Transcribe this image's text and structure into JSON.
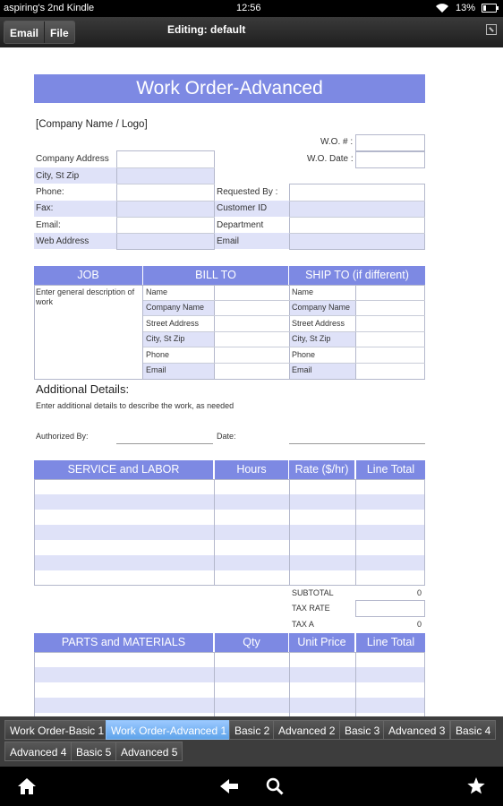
{
  "status": {
    "device": "aspiring's 2nd Kindle",
    "time": "12:56",
    "battery": "13%"
  },
  "appbar": {
    "email_label": "Email",
    "file_label": "File",
    "title": "Editing: default"
  },
  "doc": {
    "title": "Work Order-Advanced",
    "company_logo": "[Company Name / Logo]",
    "wo_num_label": "W.O. # :",
    "wo_date_label": "W.O. Date :",
    "company_address": "Company Address",
    "city_st_zip": "City, St Zip",
    "phone": "Phone:",
    "fax": "Fax:",
    "email": "Email:",
    "web_address": "Web Address",
    "requested_by": "Requested By :",
    "customer_id": "Customer ID",
    "department": "Department",
    "email2": "Email",
    "job_header": "JOB",
    "bill_to_header": "BILL TO",
    "ship_to_header": "SHIP TO (if different)",
    "job_desc": "Enter general description of work",
    "bill_fields": [
      "Name",
      "Company Name",
      "Street Address",
      "City, St Zip",
      "Phone",
      "Email"
    ],
    "ship_fields": [
      "Name",
      "Company Name",
      "Street Address",
      "City, St Zip",
      "Phone",
      "Email"
    ],
    "additional_details_label": "Additional Details:",
    "additional_details_text": "Enter additional details to describe the work, as needed",
    "authorized_by": "Authorized By:",
    "date": "Date:",
    "service_header": [
      "SERVICE and LABOR",
      "Hours",
      "Rate ($/hr)",
      "Line Total"
    ],
    "subtotal_label": "SUBTOTAL",
    "subtotal_value": "0",
    "tax_rate_label": "TAX RATE",
    "tax_a_label": "TAX A",
    "tax_a_value": "0",
    "parts_header": [
      "PARTS and MATERIALS",
      "Qty",
      "Unit Price",
      "Line Total"
    ]
  },
  "tabs": [
    "Work Order-Basic 1",
    "Work Order-Advanced 1",
    "Basic 2",
    "Advanced 2",
    "Basic 3",
    "Advanced 3",
    "Basic 4",
    "Advanced 4",
    "Basic 5",
    "Advanced 5"
  ],
  "active_tab": "Work Order-Advanced 1",
  "nav": {
    "icons": [
      "home-icon",
      "back-icon",
      "search-icon",
      "favorite-icon"
    ]
  },
  "colors": {
    "header": "#7d89e3",
    "shade": "#dfe2f8",
    "active_tab": "#5ea3ea"
  }
}
